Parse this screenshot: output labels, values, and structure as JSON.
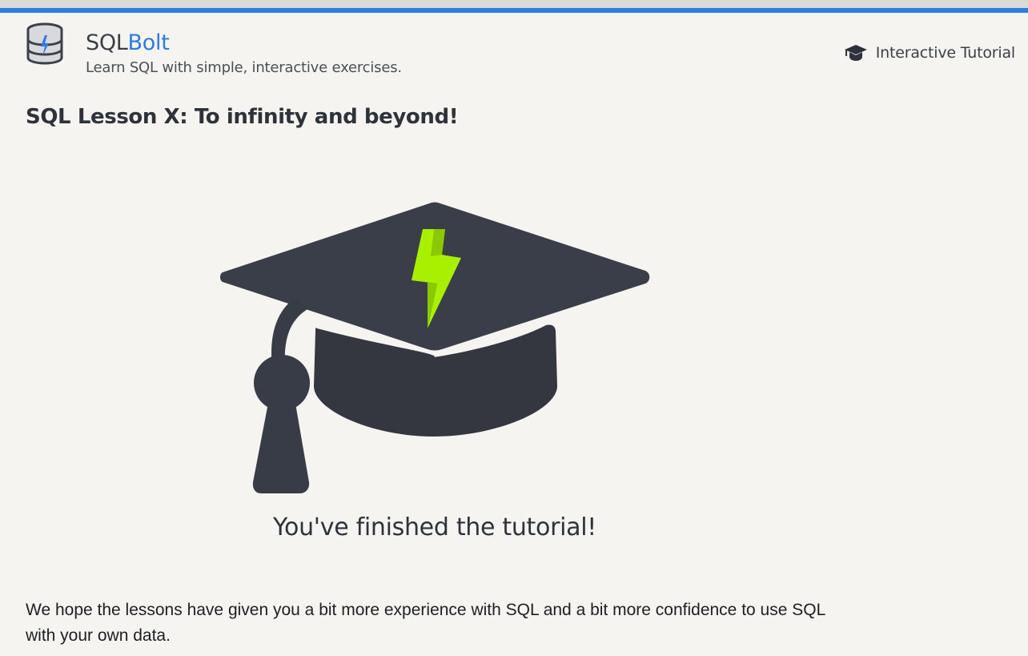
{
  "header": {
    "brand_prefix": "SQL",
    "brand_suffix": "Bolt",
    "subtitle": "Learn SQL with simple, interactive exercises.",
    "nav_label": "Interactive Tutorial",
    "logo_icon": "database-bolt-icon",
    "nav_icon": "graduation-cap-icon"
  },
  "lesson": {
    "title": "SQL Lesson X: To infinity and beyond!",
    "hero_icon": "graduation-cap-bolt-icon",
    "finish_message": "You've finished the tutorial!",
    "body": "We hope the lessons have given you a bit more experience with SQL and a bit more confidence to use SQL with your own data."
  },
  "colors": {
    "accent": "#2f7ae5",
    "text_dark": "#2e323a",
    "cap_fill": "#383c46",
    "bolt_green": "#a8f000",
    "background": "#f6f4f0"
  }
}
